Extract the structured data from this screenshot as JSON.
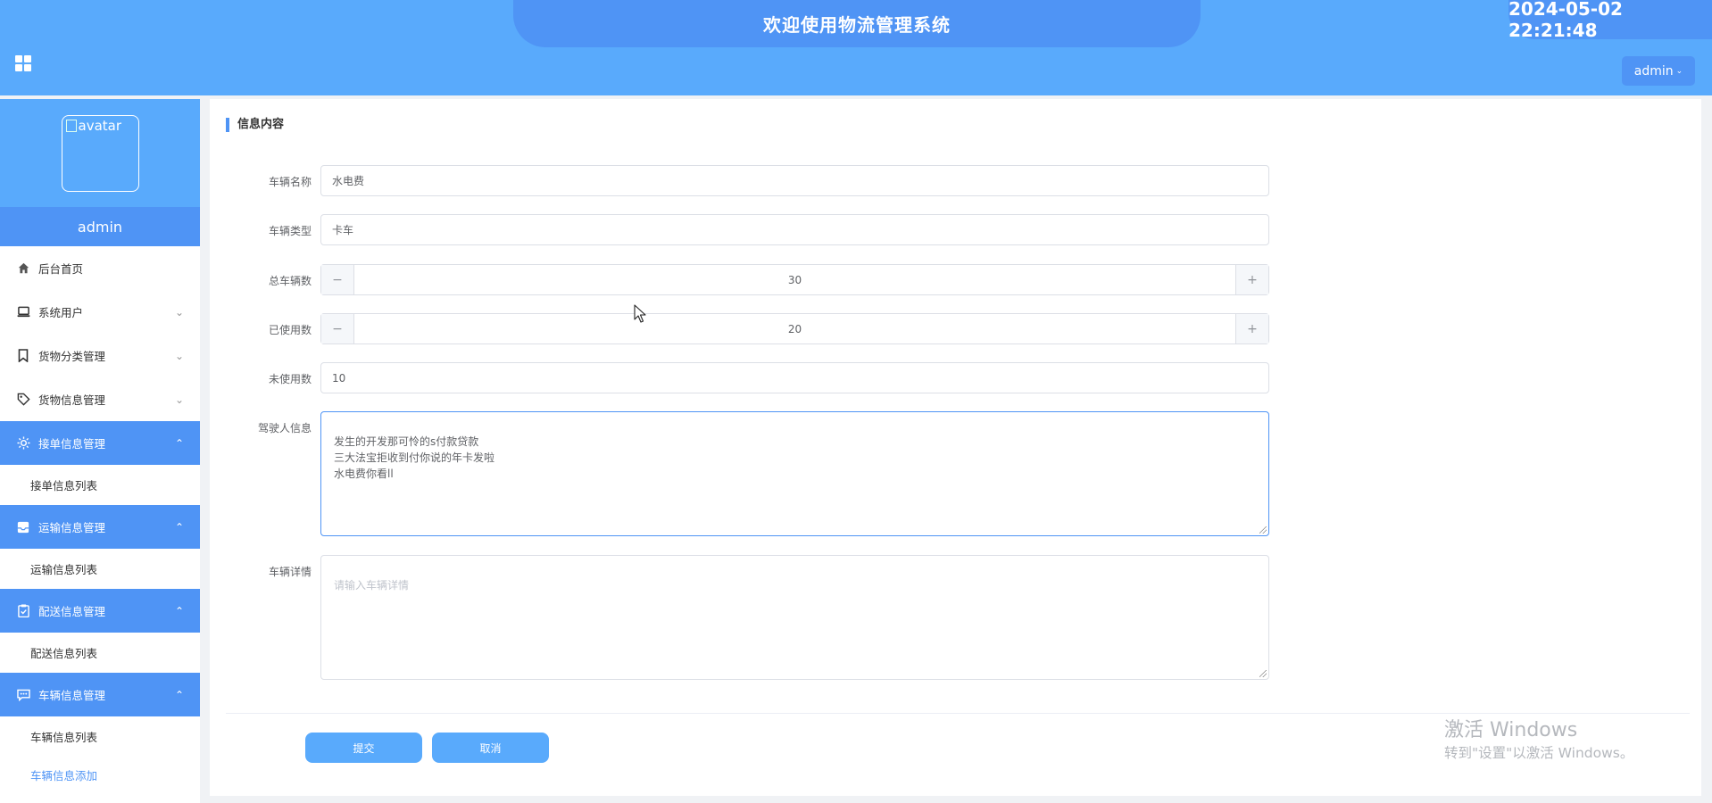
{
  "header": {
    "title": "欢迎使用物流管理系统",
    "datetime": "2024-05-02 22:21:48",
    "user_label": "admin"
  },
  "sidebar": {
    "avatar_alt": "avatar",
    "username": "admin",
    "items": [
      {
        "label": "后台首页",
        "icon": "home-icon"
      },
      {
        "label": "系统用户",
        "icon": "monitor-icon"
      },
      {
        "label": "货物分类管理",
        "icon": "bookmark-icon"
      },
      {
        "label": "货物信息管理",
        "icon": "tag-icon"
      },
      {
        "label": "接单信息管理",
        "icon": "sun-icon",
        "sub": "接单信息列表"
      },
      {
        "label": "运输信息管理",
        "icon": "inbox-icon",
        "sub": "运输信息列表"
      },
      {
        "label": "配送信息管理",
        "icon": "clipboard-icon",
        "sub": "配送信息列表"
      },
      {
        "label": "车辆信息管理",
        "icon": "message-icon",
        "sub": "车辆信息列表",
        "sub2": "车辆信息添加"
      }
    ]
  },
  "main": {
    "section_title": "信息内容",
    "form": {
      "vehicle_name_label": "车辆名称",
      "vehicle_name_value": "水电费",
      "vehicle_type_label": "车辆类型",
      "vehicle_type_value": "卡车",
      "total_label": "总车辆数",
      "total_value": "30",
      "used_label": "已使用数",
      "used_value": "20",
      "unused_label": "未使用数",
      "unused_value": "10",
      "driver_label": "驾驶人信息",
      "driver_value": "发生的开发那可怜的s付款贷款\n三大法宝拒收到付你说的年卡发啦\n水电费你看ll",
      "detail_label": "车辆详情",
      "detail_placeholder": "请输入车辆详情"
    },
    "submit_label": "提交",
    "cancel_label": "取消"
  },
  "watermark": {
    "line1": "激活 Windows",
    "line2": "转到\"设置\"以激活 Windows。"
  }
}
